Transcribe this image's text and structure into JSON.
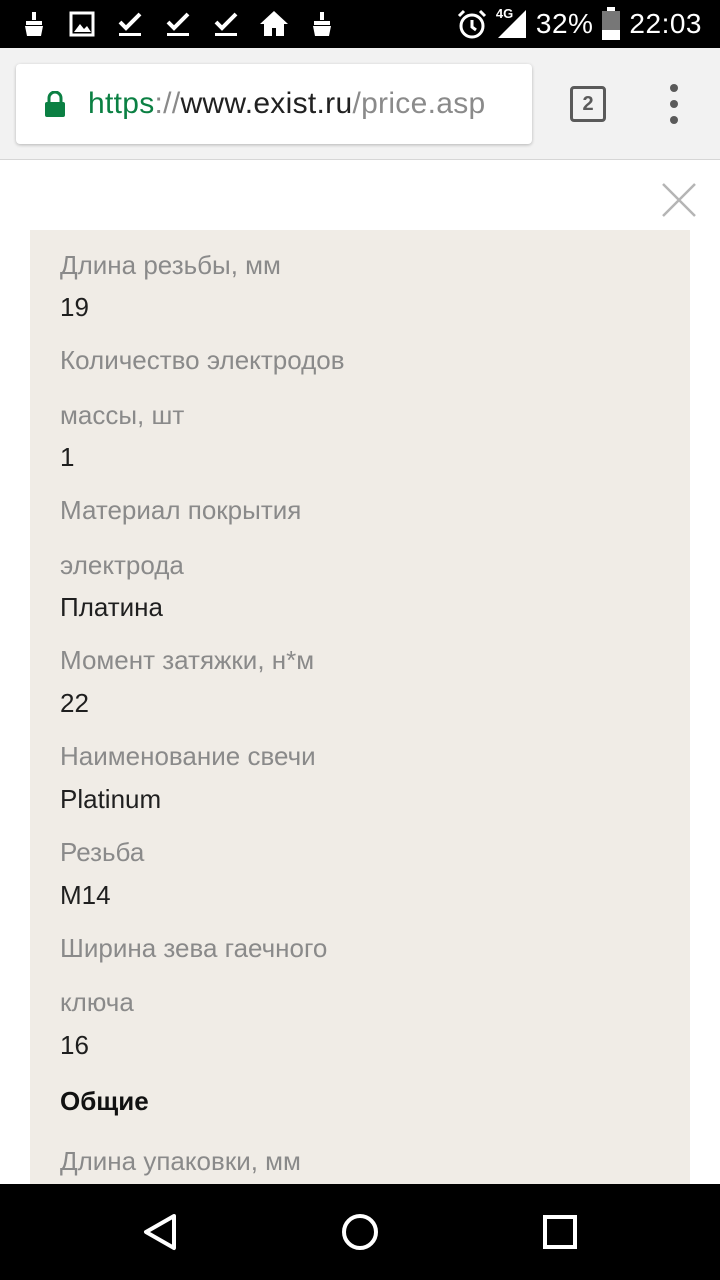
{
  "status_bar": {
    "network": "4G",
    "battery": "32%",
    "time": "22:03"
  },
  "browser": {
    "url_scheme": "https",
    "url_separator": "://",
    "url_host": "www.exist.ru",
    "url_path": "/price.asp",
    "tab_count": "2"
  },
  "specs": {
    "thread_length_label": "Длина резьбы, мм",
    "thread_length_value": "19",
    "electrodes_label_line1": "Количество электродов",
    "electrodes_label_line2": "массы, шт",
    "electrodes_value": "1",
    "coating_label_line1": "Материал покрытия",
    "coating_label_line2": "электрода",
    "coating_value": "Платина",
    "torque_label": "Момент затяжки, н*м",
    "torque_value": "22",
    "plug_name_label": "Наименование свечи",
    "plug_name_value": "Platinum",
    "thread_label": "Резьба",
    "thread_value": "M14",
    "wrench_label_line1": "Ширина зева гаечного",
    "wrench_label_line2": "ключа",
    "wrench_value": "16",
    "section_general": "Общие",
    "package_length_label": "Длина упаковки, мм"
  },
  "colors": {
    "panel_background": "#f0ece6",
    "label_text": "#8a8a8a",
    "value_text": "#1f1f1f",
    "secure_scheme": "#0b8043"
  }
}
